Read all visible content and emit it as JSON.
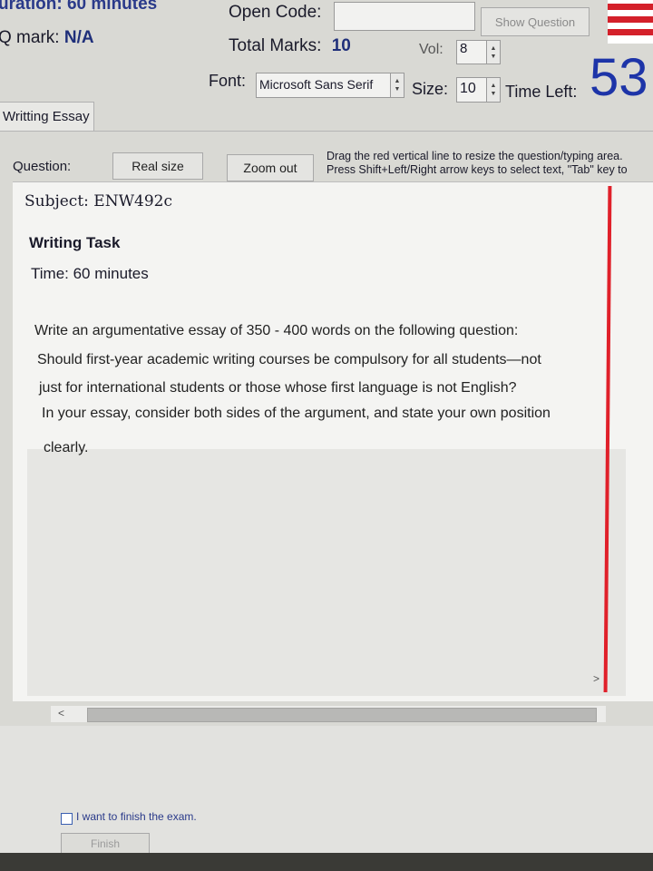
{
  "header": {
    "duration_text": "uration: 60 minutes",
    "q_mark_label": "Q mark:",
    "q_mark_value": "N/A",
    "open_code_label": "Open Code:",
    "open_code_value": "",
    "show_question_label": "Show Question",
    "total_marks_label": "Total Marks:",
    "total_marks_value": "10",
    "vol_label": "Vol:",
    "vol_value": "8",
    "font_label": "Font:",
    "font_value": "Microsoft Sans Serif",
    "size_label": "Size:",
    "size_value": "10",
    "time_left_label": "Time Left:",
    "time_left_value": "53"
  },
  "tab": {
    "label": "Writting Essay"
  },
  "toolbar": {
    "question_label": "Question:",
    "real_size_label": "Real size",
    "zoom_out_label": "Zoom out",
    "hint_line1": "Drag the red vertical line to resize the question/typing area.",
    "hint_line2": "Press Shift+Left/Right arrow keys to select text, \"Tab\" key to"
  },
  "question": {
    "subject": "Subject: ENW492c",
    "task_title": "Writing Task",
    "time": "Time: 60 minutes",
    "prompt_lines": [
      "Write an argumentative essay of 350  -  400 words on the following question:",
      "Should first-year academic writing courses be compulsory for all students—not",
      "just for international students or those whose first language is not English?",
      "In your essay, consider both sides of the argument, and state your own position",
      "clearly."
    ]
  },
  "footer": {
    "finish_checkbox_label": "I want to finish the exam.",
    "finish_button_label": "Finish"
  },
  "icons": {
    "scroll_left": "<",
    "scroll_right": ">"
  },
  "colors": {
    "accent_blue": "#1f2f7a",
    "divider_red": "#e0202a"
  }
}
